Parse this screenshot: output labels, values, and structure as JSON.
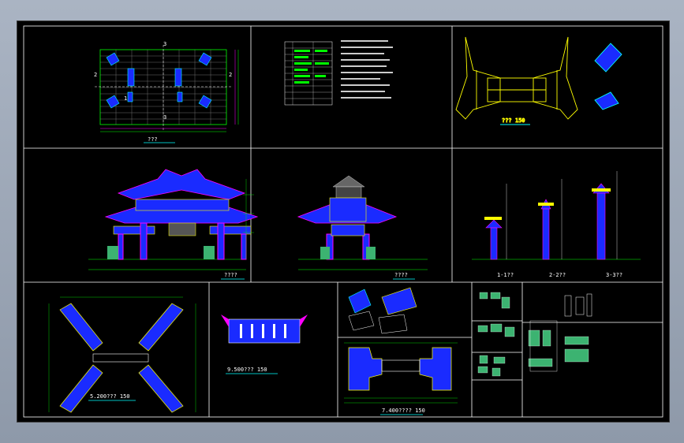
{
  "drawing": {
    "panels": {
      "plan": {
        "caption": "??? "
      },
      "table": {
        "caption": ""
      },
      "roof_plan": {
        "caption": "???  150"
      },
      "front_elev": {
        "caption": "????"
      },
      "side_elev": {
        "caption": "????"
      },
      "sections": {
        "caption_1": "1-1??",
        "caption_2": "2-2??",
        "caption_3": "3-3??"
      },
      "plan_5200": {
        "caption": "5.200???  150"
      },
      "plan_9500": {
        "caption": "9.500???  150"
      },
      "plan_7400": {
        "caption": "7.400????  150"
      }
    },
    "plan_marks": {
      "top": "3",
      "bottom": "3",
      "left": "2",
      "right": "2",
      "mid": "1"
    }
  }
}
